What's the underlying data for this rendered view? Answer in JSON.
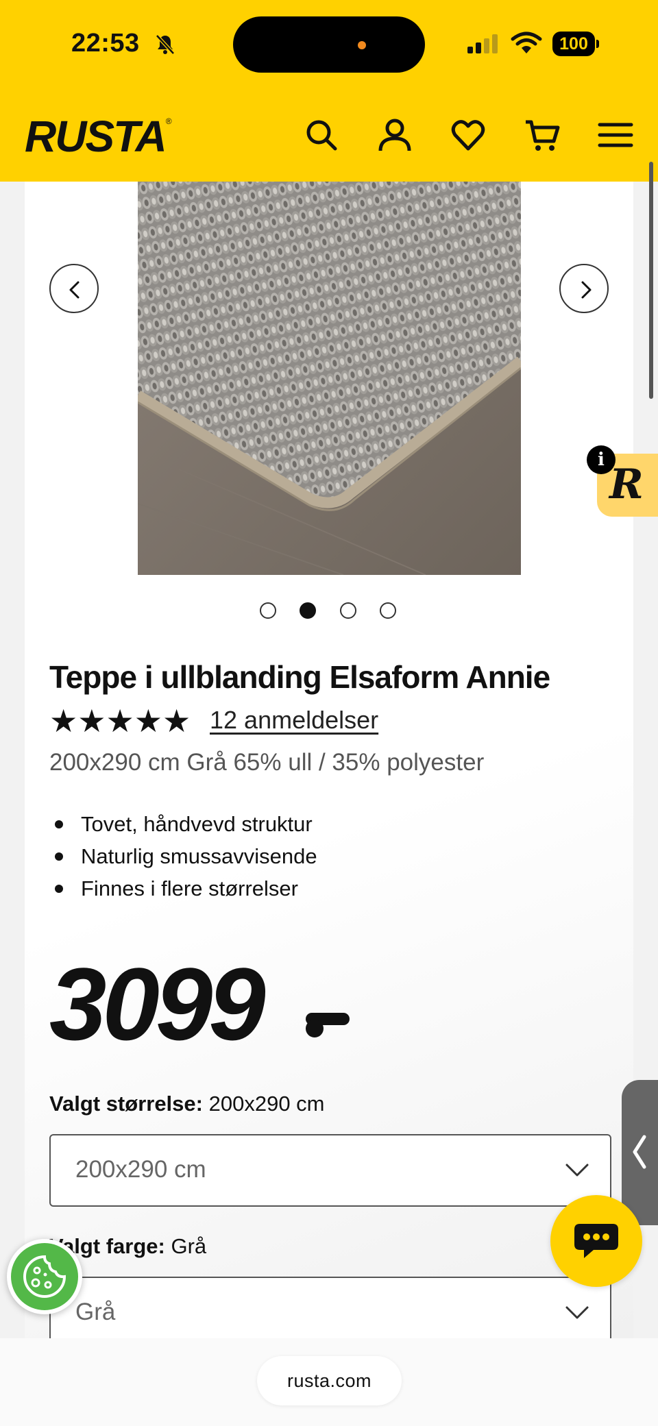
{
  "status_bar": {
    "time": "22:53",
    "battery": "100"
  },
  "header": {
    "logo": "RUSTA",
    "icons": [
      "search-icon",
      "account-icon",
      "heart-icon",
      "cart-icon",
      "menu-icon"
    ]
  },
  "carousel": {
    "image_count": 4,
    "active_index": 1
  },
  "product": {
    "title": "Teppe i ullblanding Elsaform Annie",
    "stars": "★★★★★",
    "rating": 5,
    "reviews_link": "12 anmeldelser",
    "subtitle": "200x290 cm Grå 65% ull / 35% polyester",
    "features": [
      "Tovet, håndvevd struktur",
      "Naturlig smussavvisende",
      "Finnes i flere størrelser"
    ],
    "price": "3099"
  },
  "size": {
    "label": "Valgt størrelse:",
    "value": "200x290 cm",
    "selected": "200x290 cm"
  },
  "color": {
    "label": "Valgt farge:",
    "value": "Grå",
    "selected": "Grå"
  },
  "widget": {
    "info": "i",
    "letter": "R"
  },
  "browser": {
    "url": "rusta.com"
  },
  "colors": {
    "brand_yellow": "#ffd100",
    "cookie_green": "#53b848",
    "text": "#111111"
  }
}
